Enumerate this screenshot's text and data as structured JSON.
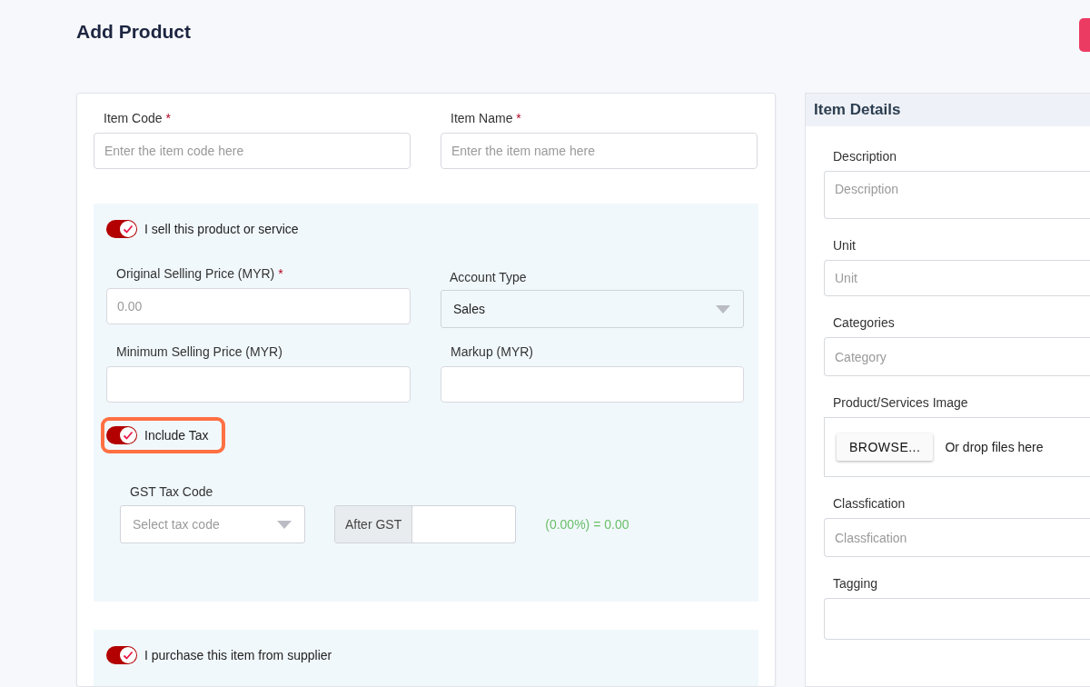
{
  "page": {
    "title": "Add Product"
  },
  "item_fields": [
    {
      "label": "Item Code",
      "asterisk": "*",
      "placeholder": "Enter the item code here"
    },
    {
      "label": "Item Name",
      "asterisk": "*",
      "placeholder": "Enter the item name here"
    }
  ],
  "sell_section": {
    "toggle": {
      "label": "I sell this product or service",
      "on": true
    },
    "fields": [
      {
        "kind": "input",
        "label": "Original Selling Price (MYR)",
        "asterisk": "*",
        "placeholder": "0.00"
      },
      {
        "kind": "select",
        "label": "Account Type",
        "value": "Sales"
      },
      {
        "kind": "input",
        "label": "Minimum Selling Price (MYR)"
      },
      {
        "kind": "input",
        "label": "Markup (MYR)"
      }
    ],
    "tax_toggle": {
      "label": "Include Tax",
      "on": true,
      "highlighted": true
    },
    "gst": {
      "label": "GST Tax Code",
      "placeholder": "Select tax code",
      "addon": "After GST",
      "result": "(0.00%) = 0.00"
    }
  },
  "purchase_section": {
    "toggle": {
      "label": "I purchase this item from supplier",
      "on": true
    }
  },
  "item_details": {
    "title": "Item Details",
    "fields": [
      {
        "kind": "textarea",
        "label": "Description",
        "placeholder": "Description"
      },
      {
        "kind": "input",
        "label": "Unit",
        "placeholder": "Unit"
      },
      {
        "kind": "input",
        "label": "Categories",
        "placeholder": "Category"
      },
      {
        "kind": "file",
        "label": "Product/Services Image",
        "button": "BROWSE...",
        "hint": "Or drop files here"
      },
      {
        "kind": "input",
        "label": "Classfication",
        "placeholder": "Classfication"
      },
      {
        "kind": "input",
        "label": "Tagging"
      }
    ]
  }
}
